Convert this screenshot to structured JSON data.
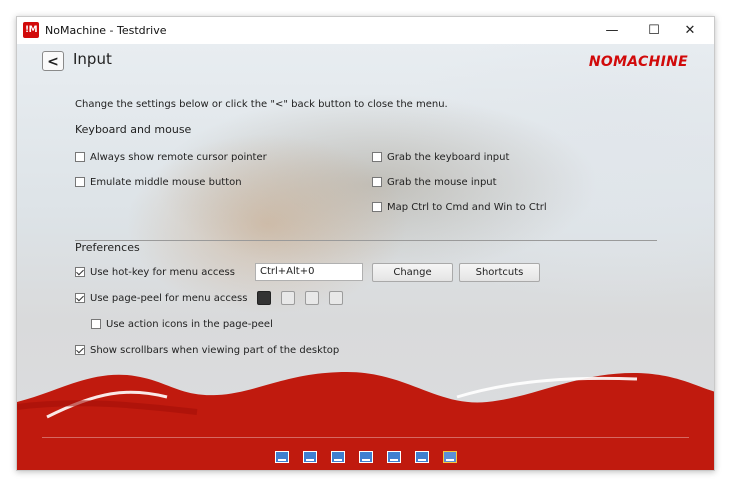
{
  "window": {
    "title": "NoMachine - Testdrive",
    "app_icon_text": "!M",
    "minimize": "—",
    "maximize": "☐",
    "close": "✕"
  },
  "header": {
    "back_label": "<",
    "page_title": "Input",
    "logo": "NOMACHINE"
  },
  "intro": "Change the settings below or click the \"<\" back button to close the menu.",
  "keyboard": {
    "section_title": "Keyboard and mouse",
    "options": [
      {
        "label": "Always show remote cursor pointer",
        "checked": false
      },
      {
        "label": "Emulate middle mouse button",
        "checked": false
      },
      {
        "label": "Grab the keyboard input",
        "checked": false
      },
      {
        "label": "Grab the mouse input",
        "checked": false
      },
      {
        "label": "Map Ctrl to Cmd and Win to Ctrl",
        "checked": false
      }
    ]
  },
  "preferences": {
    "section_title": "Preferences",
    "hotkey": {
      "label": "Use hot-key for menu access",
      "checked": true,
      "value": "Ctrl+Alt+0"
    },
    "change_button": "Change",
    "shortcuts_button": "Shortcuts",
    "page_peel": {
      "label": "Use page-peel for menu access",
      "checked": true
    },
    "action_icons": {
      "label": "Use action icons in the page-peel",
      "checked": false
    },
    "scrollbars": {
      "label": "Show scrollbars when viewing part of the desktop",
      "checked": true
    }
  },
  "footer_icons": [
    "fit-icon",
    "resize-icon",
    "scale-icon",
    "keyboard-icon",
    "fullscreen-icon",
    "display-icon",
    "settings-icon"
  ],
  "colors": {
    "brand_red": "#d10a0a",
    "wave_red": "#c01a0e"
  }
}
